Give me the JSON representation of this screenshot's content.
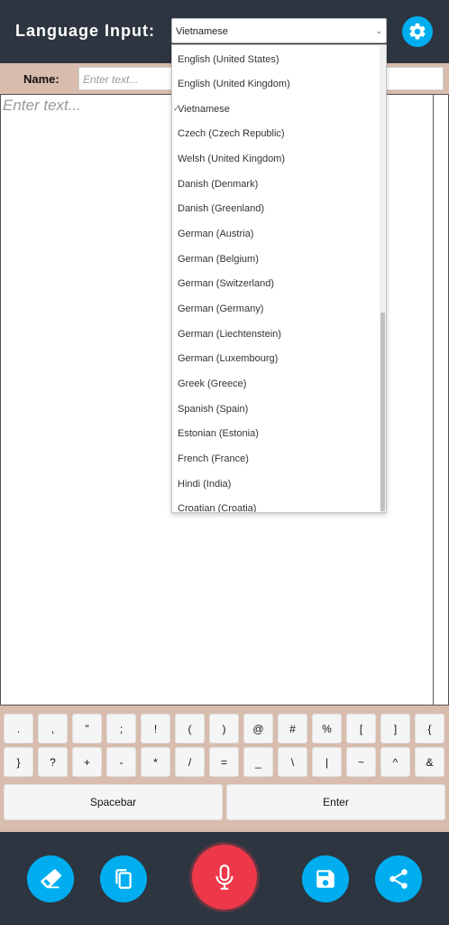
{
  "header": {
    "title": "Language Input:",
    "selected_language": "Vietnamese",
    "settings_icon": "gear-icon"
  },
  "name_field": {
    "label": "Name:",
    "placeholder": "Enter text..."
  },
  "text_area": {
    "placeholder": "Enter text..."
  },
  "dropdown": {
    "selected": "Vietnamese",
    "options": [
      "English (United States)",
      "English (United Kingdom)",
      "Vietnamese",
      "Czech (Czech Republic)",
      "Welsh (United Kingdom)",
      "Danish (Denmark)",
      "Danish (Greenland)",
      "German (Austria)",
      "German (Belgium)",
      "German (Switzerland)",
      "German (Germany)",
      "German (Liechtenstein)",
      "German (Luxembourg)",
      "Greek (Greece)",
      "Spanish (Spain)",
      "Estonian (Estonia)",
      "French (France)",
      "Hindi (India)",
      "Croatian (Croatia)"
    ]
  },
  "keyboard": {
    "row1": [
      ".",
      ",",
      "\"",
      ";",
      "!",
      "(",
      ")",
      "@",
      "#",
      "%",
      "[",
      "]",
      "{"
    ],
    "row2": [
      "}",
      "?",
      "+",
      "-",
      "*",
      "/",
      "=",
      "_",
      "\\",
      "|",
      "~",
      "^",
      "&"
    ],
    "spacebar_label": "Spacebar",
    "enter_label": "Enter"
  },
  "footer": {
    "buttons": [
      "eraser-icon",
      "copy-icon",
      "microphone-icon",
      "save-icon",
      "share-icon"
    ]
  },
  "colors": {
    "header_bg": "#2d3540",
    "accent": "#00aef0",
    "mic": "#ec3848",
    "panel_bg": "#d8bcae"
  }
}
